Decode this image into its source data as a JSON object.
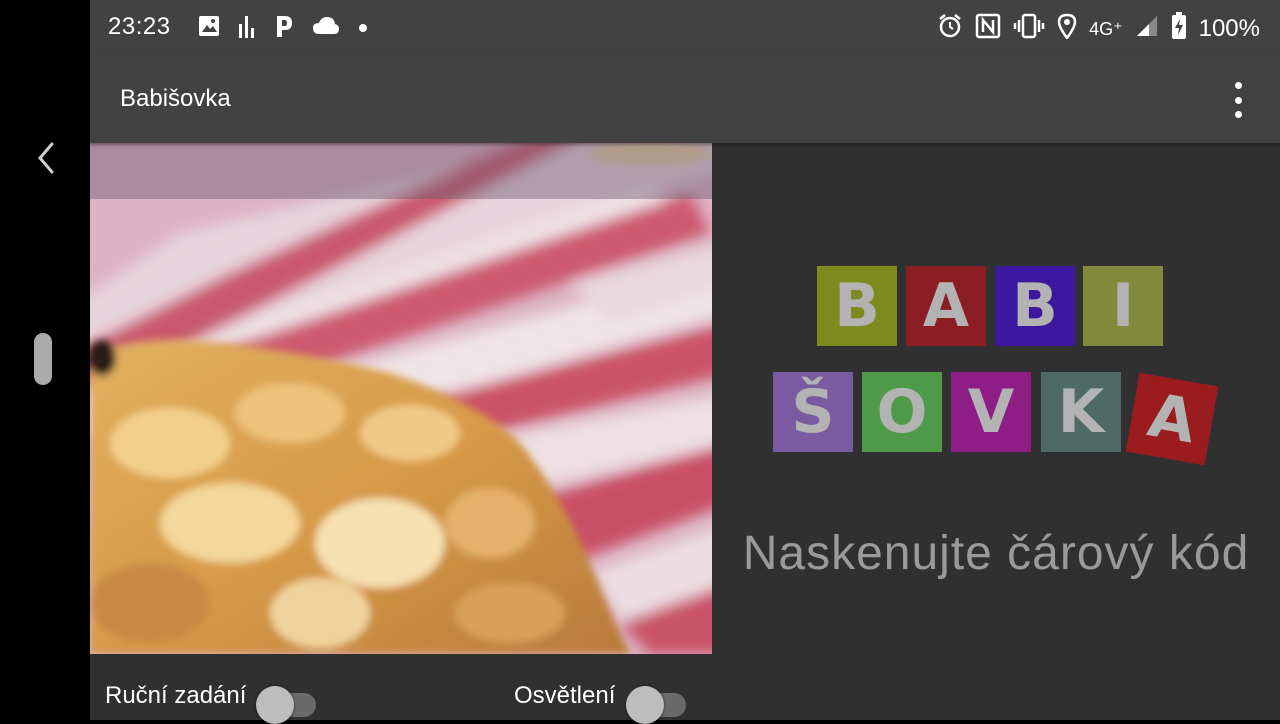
{
  "status_bar": {
    "time": "23:23",
    "left_icons": [
      "image-icon",
      "bar-chart-icon",
      "parking-icon",
      "cloud-icon",
      "dot-icon"
    ],
    "right_icons": [
      "alarm-icon",
      "nfc-icon",
      "vibrate-icon",
      "location-icon",
      "network-4g-icon",
      "signal-icon",
      "battery-charging-icon"
    ],
    "network": "4G⁺",
    "battery": "100%"
  },
  "app_bar": {
    "title": "Babišovka",
    "menu_icon": "more-vert-icon"
  },
  "nav": {
    "back_icon": "back-chevron-icon"
  },
  "logo": {
    "row1": [
      "B",
      "A",
      "B",
      "I"
    ],
    "row2": [
      "Š",
      "O",
      "V",
      "K",
      "A"
    ],
    "row1_colors": [
      "#7d8a1e",
      "#8c1d24",
      "#3c18a0",
      "#808a3a"
    ],
    "row2_colors": [
      "#7a5aa0",
      "#4f9a48",
      "#8e1e86",
      "#4d6a64",
      "#9a1c1e"
    ]
  },
  "scan_prompt": "Naskenujte čárový kód",
  "controls": {
    "manual_entry_label": "Ruční zadání",
    "manual_entry_on": false,
    "light_label": "Osvětlení",
    "light_on": false
  }
}
